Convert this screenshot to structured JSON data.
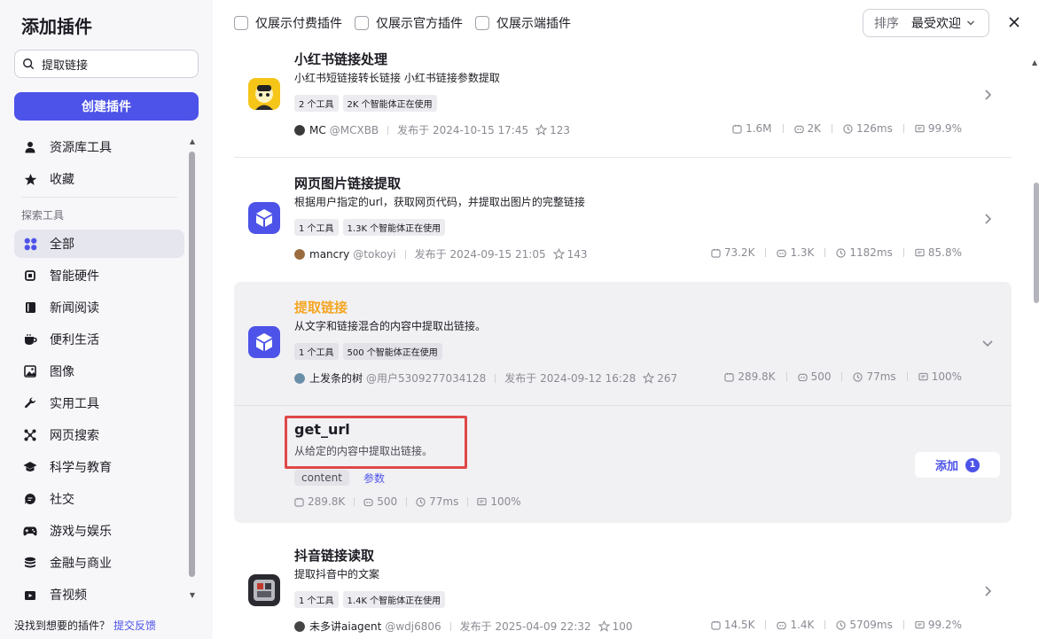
{
  "sidebar": {
    "title": "添加插件",
    "search_value": "提取链接",
    "create_label": "创建插件",
    "top_items": [
      {
        "label": "资源库工具",
        "icon": "user-icon"
      },
      {
        "label": "收藏",
        "icon": "star-icon"
      }
    ],
    "section_label": "探索工具",
    "items": [
      {
        "label": "全部",
        "icon": "grid-icon",
        "active": true
      },
      {
        "label": "智能硬件",
        "icon": "chip-icon"
      },
      {
        "label": "新闻阅读",
        "icon": "book-icon"
      },
      {
        "label": "便利生活",
        "icon": "cup-icon"
      },
      {
        "label": "图像",
        "icon": "image-icon"
      },
      {
        "label": "实用工具",
        "icon": "wrench-icon"
      },
      {
        "label": "网页搜索",
        "icon": "network-icon"
      },
      {
        "label": "科学与教育",
        "icon": "graduation-icon"
      },
      {
        "label": "社交",
        "icon": "chat-icon"
      },
      {
        "label": "游戏与娱乐",
        "icon": "gamepad-icon"
      },
      {
        "label": "金融与商业",
        "icon": "coins-icon"
      },
      {
        "label": "音视频",
        "icon": "video-icon"
      }
    ],
    "feedback_text": "没找到想要的插件？",
    "feedback_link": "提交反馈"
  },
  "filters": {
    "paid": "仅展示付费插件",
    "official": "仅展示官方插件",
    "client": "仅展示端插件"
  },
  "sort": {
    "label": "排序",
    "value": "最受欢迎"
  },
  "plugins": [
    {
      "name": "小红书链接处理",
      "desc": "小红书短链接转长链接 小红书链接参数提取",
      "tags": [
        "2 个工具",
        "2K 个智能体正在使用"
      ],
      "author": "MC",
      "handle": "@MCXBB",
      "published": "发布于 2024-10-15 17:45",
      "stars": "123",
      "stats": [
        "1.6M",
        "2K",
        "126ms",
        "99.9%"
      ]
    },
    {
      "name": "网页图片链接提取",
      "desc": "根据用户指定的url，获取网页代码，并提取出图片的完整链接",
      "tags": [
        "1 个工具",
        "1.3K 个智能体正在使用"
      ],
      "author": "mancry",
      "handle": "@tokoyi",
      "published": "发布于 2024-09-15 21:05",
      "stars": "143",
      "stats": [
        "73.2K",
        "1.3K",
        "1182ms",
        "85.8%"
      ]
    },
    {
      "name": "提取链接",
      "desc": "从文字和链接混合的内容中提取出链接。",
      "tags": [
        "1 个工具",
        "500 个智能体正在使用"
      ],
      "author": "上发条的树",
      "handle": "@用户5309277034128",
      "published": "发布于 2024-09-12 16:28",
      "stars": "267",
      "stats": [
        "289.8K",
        "500",
        "77ms",
        "100%"
      ]
    },
    {
      "name": "抖音链接读取",
      "desc": "提取抖音中的文案",
      "tags": [
        "1 个工具",
        "1.4K 个智能体正在使用"
      ],
      "author": "未多讲aiagent",
      "handle": "@wdj6806",
      "published": "发布于 2025-04-09 22:32",
      "stars": "100",
      "stats": [
        "14.5K",
        "1.4K",
        "5709ms",
        "99.2%"
      ]
    }
  ],
  "tool": {
    "name": "get_url",
    "desc": "从给定的内容中提取出链接。",
    "param": "content",
    "param_link": "参数",
    "stats": [
      "289.8K",
      "500",
      "77ms",
      "100%"
    ],
    "add_label": "添加",
    "add_count": "1"
  },
  "colors": {
    "accent": "#4d53e8",
    "highlight_name": "#f5a623",
    "highlight_box": "#e04848"
  }
}
